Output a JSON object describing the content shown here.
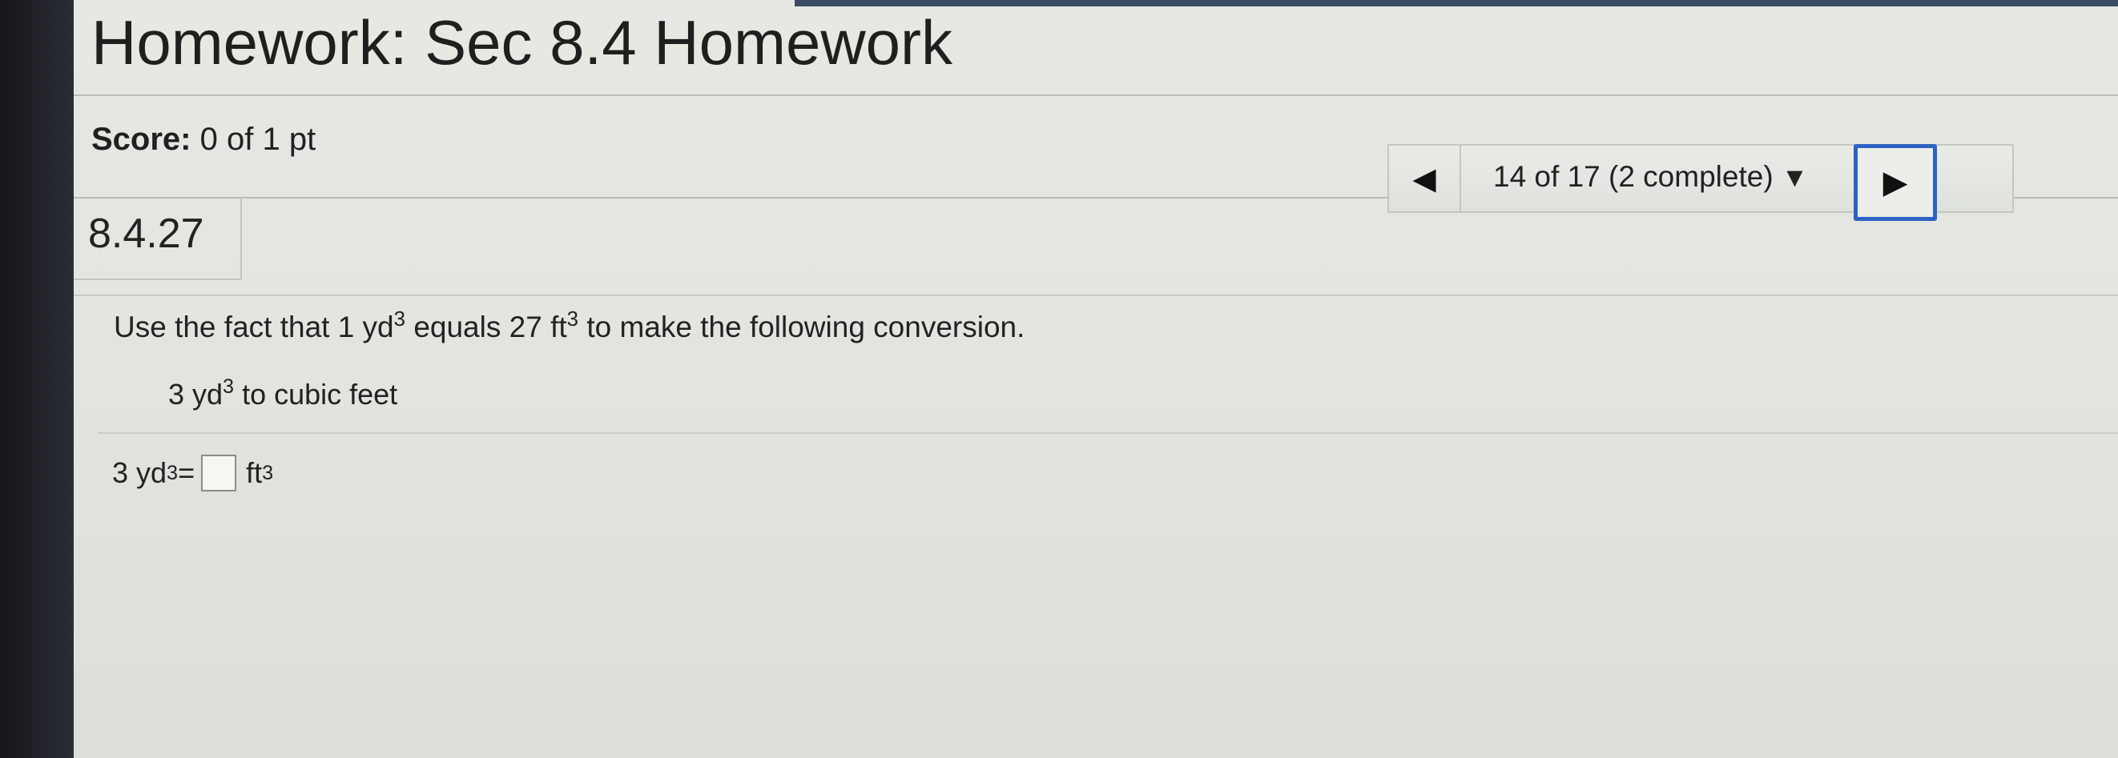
{
  "header": {
    "title": "Homework: Sec 8.4 Homework"
  },
  "score": {
    "label": "Score:",
    "value": "0 of 1 pt"
  },
  "navigation": {
    "prev_icon": "triangle-left-icon",
    "progress_text": "14 of 17 (2 complete)",
    "dropdown_icon": "triangle-down-icon",
    "next_icon": "triangle-right-icon",
    "next_border_color": "#2b63c4"
  },
  "question": {
    "number": "8.4.27",
    "instruction_part1": "Use the fact that 1 yd",
    "instruction_exp1": "3",
    "instruction_part2": " equals 27 ft",
    "instruction_exp2": "3",
    "instruction_part3": " to make the following conversion.",
    "given_value": "3 yd",
    "given_exp": "3",
    "given_rest": " to cubic feet",
    "answer_lhs": "3 yd",
    "answer_lhs_exp": "3",
    "answer_eq": " =",
    "answer_value": "",
    "answer_unit": "ft",
    "answer_unit_exp": "3"
  }
}
